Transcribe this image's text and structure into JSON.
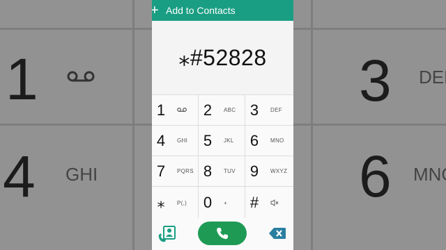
{
  "header": {
    "plus_glyph": "+",
    "add_to_contacts_label": "Add to Contacts"
  },
  "dialer": {
    "entered_number": "⁎#52828"
  },
  "keypad": [
    {
      "digit": "1",
      "letters": "",
      "icon": "voicemail-icon"
    },
    {
      "digit": "2",
      "letters": "ABC"
    },
    {
      "digit": "3",
      "letters": "DEF"
    },
    {
      "digit": "4",
      "letters": "GHI"
    },
    {
      "digit": "5",
      "letters": "JKL"
    },
    {
      "digit": "6",
      "letters": "MNO"
    },
    {
      "digit": "7",
      "letters": "PQRS"
    },
    {
      "digit": "8",
      "letters": "TUV"
    },
    {
      "digit": "9",
      "letters": "WXYZ"
    },
    {
      "digit": "⁎",
      "letters": "P(,)"
    },
    {
      "digit": "0",
      "letters": "+"
    },
    {
      "digit": "#",
      "letters": "",
      "icon": "mute-icon"
    }
  ],
  "background": {
    "left_digits": [
      "1",
      "4"
    ],
    "left_letters": [
      "",
      "GHI"
    ],
    "right_digits": [
      "3",
      "6"
    ],
    "right_letters": [
      "DEF",
      "MNO"
    ]
  },
  "actions": {
    "contacts_icon": "contacts-icon",
    "call_icon": "phone-icon",
    "backspace_icon": "backspace-icon"
  },
  "colors": {
    "header": "#1a9e83",
    "call_button": "#1e9a54",
    "contacts_icon": "#1a9e83",
    "backspace_icon": "#2a7fa0"
  }
}
